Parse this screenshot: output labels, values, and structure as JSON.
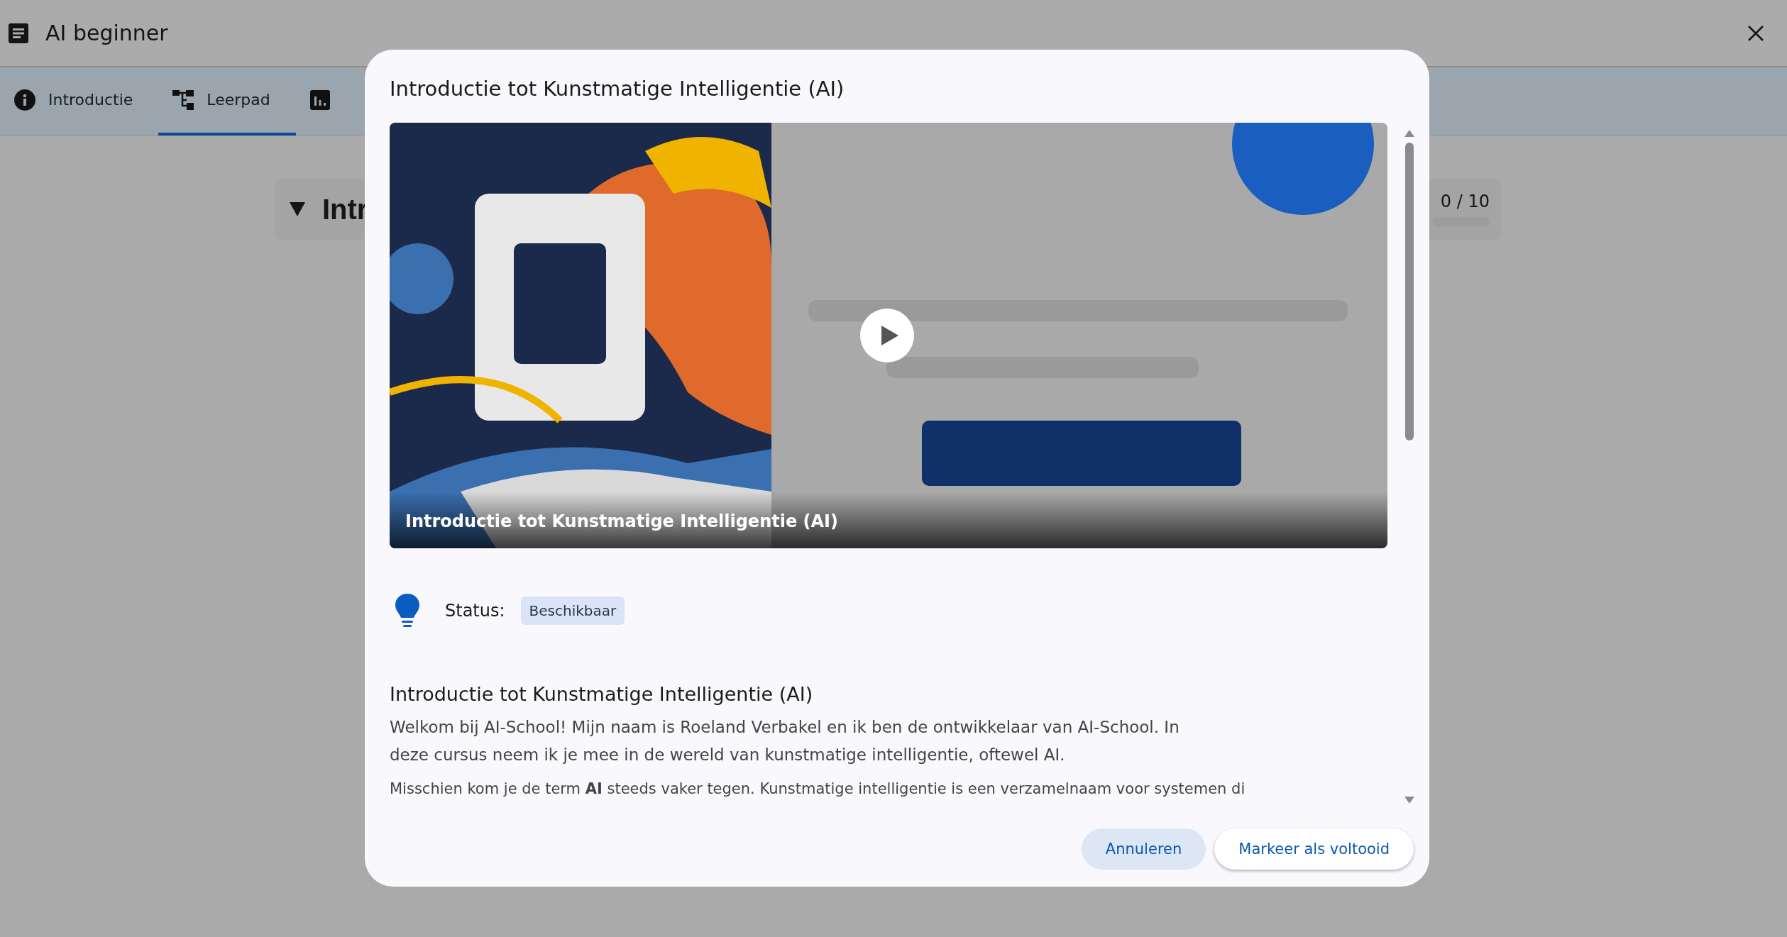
{
  "header": {
    "title": "AI beginner"
  },
  "tabs": [
    {
      "label": "Introductie",
      "kind": "info",
      "selected": false
    },
    {
      "label": "Leerpad",
      "kind": "path",
      "selected": true
    },
    {
      "kind": "chart",
      "selected": false
    }
  ],
  "section": {
    "title": "Intr",
    "progress": "0 / 10",
    "level": 0
  },
  "dialog": {
    "title": "Introductie tot Kunstmatige Intelligentie (AI)",
    "video": {
      "kind": "picture",
      "caption": "Introductie tot Kunstmatige Intelligentie (AI)"
    },
    "status_label": "Status:",
    "status": "Beschikbaar",
    "heading": "Introductie tot Kunstmatige Intelligentie (AI)",
    "paragraphs": [
      "Welkom bij AI-School! Mijn naam is Roeland Verbakel en ik ben de ontwikkelaar van AI-School. In deze cursus neem ik je mee in de wereld van kunstmatige intelligentie, oftewel AI.",
      "Misschien kom je de term **AI** steeds vaker tegen. Kunstmatige intelligentie is een verzamelnaam voor systemen di"
    ],
    "buttons": [
      {
        "label": "Annuleren",
        "kind": "tonal"
      },
      {
        "label": "Markeer als voltooid",
        "kind": "outlined"
      }
    ]
  }
}
